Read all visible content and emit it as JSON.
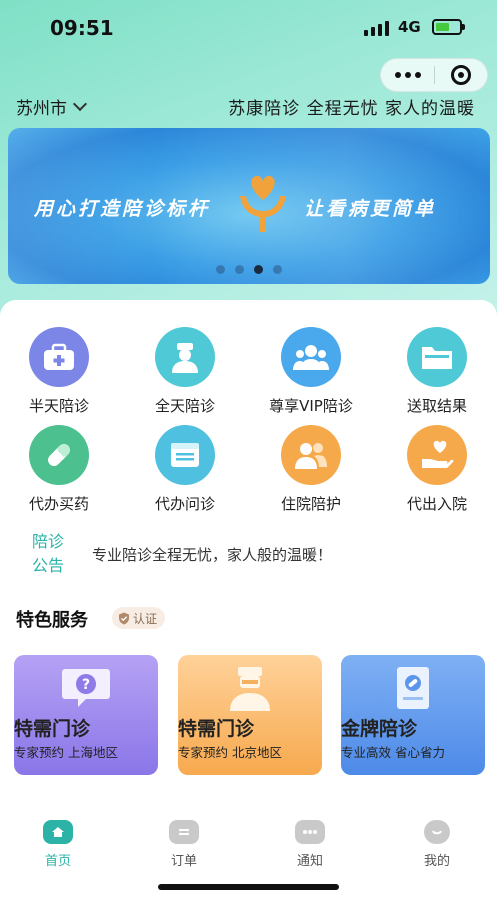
{
  "status": {
    "time": "09:51",
    "network": "4G"
  },
  "header": {
    "city": "苏州市",
    "slogan": "苏康陪诊 全程无忧 家人的温暖"
  },
  "banner": {
    "left_text": "用心打造陪诊标杆",
    "right_text": "让看病更简单",
    "pages": 4,
    "active_page": 3
  },
  "services": [
    {
      "label": "半天陪诊",
      "icon": "medical-kit-icon",
      "color": "#7b86e6"
    },
    {
      "label": "全天陪诊",
      "icon": "nurse-icon",
      "color": "#4fc9d6"
    },
    {
      "label": "尊享VIP陪诊",
      "icon": "group-icon",
      "color": "#4aa8ec"
    },
    {
      "label": "送取结果",
      "icon": "folder-icon",
      "color": "#4fc9d6"
    },
    {
      "label": "代办买药",
      "icon": "pill-icon",
      "color": "#4cc08e"
    },
    {
      "label": "代办问诊",
      "icon": "form-icon",
      "color": "#4fc0df"
    },
    {
      "label": "住院陪护",
      "icon": "caregiver-icon",
      "color": "#f5a94a"
    },
    {
      "label": "代出入院",
      "icon": "heart-hand-icon",
      "color": "#f5a94a"
    }
  ],
  "notice": {
    "title": "陪诊公告",
    "text": "专业陪诊全程无忧，家人般的温暖！"
  },
  "featured": {
    "title": "特色服务",
    "badge": "认证",
    "cards": [
      {
        "title": "特需门诊",
        "subtitle": "专家预约 上海地区",
        "icon": "question-chat-icon"
      },
      {
        "title": "特需门诊",
        "subtitle": "专家预约 北京地区",
        "icon": "doctor-icon"
      },
      {
        "title": "金牌陪诊",
        "subtitle": "专业高效 省心省力",
        "icon": "document-icon"
      }
    ]
  },
  "tabbar": {
    "items": [
      {
        "label": "首页",
        "icon": "home-icon",
        "active": true
      },
      {
        "label": "订单",
        "icon": "order-icon",
        "active": false
      },
      {
        "label": "通知",
        "icon": "chat-icon",
        "active": false
      },
      {
        "label": "我的",
        "icon": "profile-icon",
        "active": false
      }
    ]
  },
  "colors": {
    "accent": "#2bb3a8",
    "banner_blue": "#3a9ee6"
  }
}
